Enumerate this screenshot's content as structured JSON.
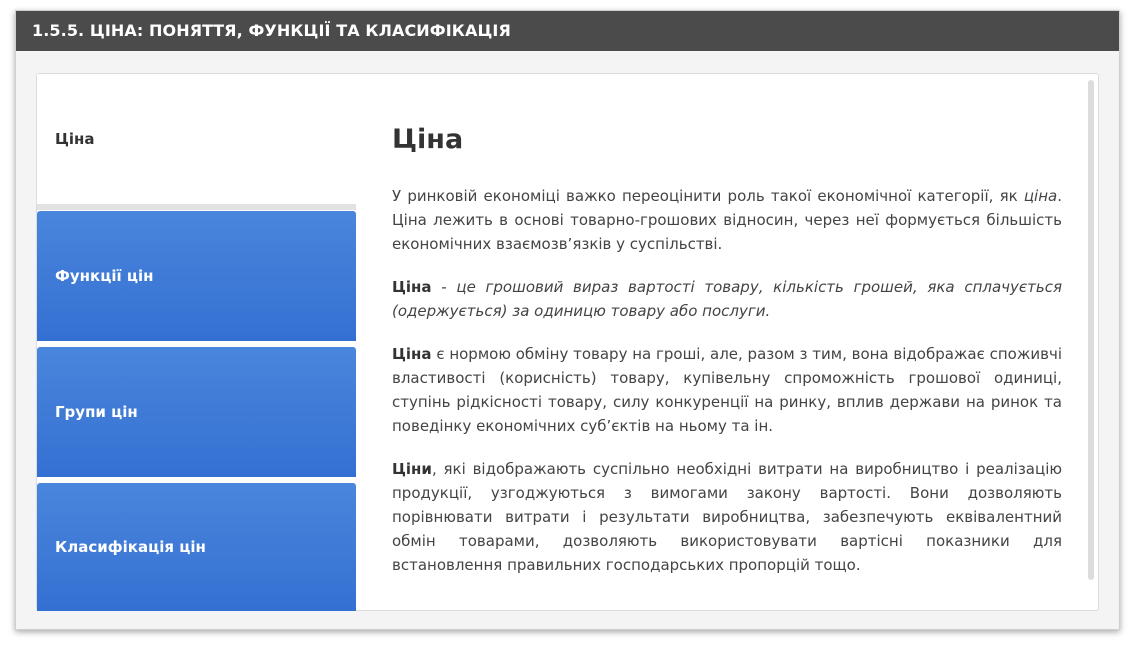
{
  "window": {
    "title": "1.5.5. ЦІНА: ПОНЯТТЯ, ФУНКЦІЇ ТА КЛАСИФІКАЦІЯ"
  },
  "tabs": [
    {
      "label": "Ціна",
      "active": true
    },
    {
      "label": "Функції цін",
      "active": false
    },
    {
      "label": "Групи цін",
      "active": false
    },
    {
      "label": "Класифікація цін",
      "active": false
    }
  ],
  "content": {
    "heading": "Ціна",
    "p1": {
      "text_a": "У ринковій економіці важко переоцінити роль такої економічної категорії, як ",
      "em": "ціна",
      "text_b": ". Ціна лежить в основі товарно-грошових відносин, через неї формується більшість економічних взаємозв’язків у суспільстві."
    },
    "p2": {
      "bold": "Ціна",
      "em": " - це грошовий вираз вартості товару, кількість грошей, яка сплачується (одержується) за одиницю товару або послуги."
    },
    "p3": {
      "bold": "Ціна",
      "text": " є нормою обміну товару на гроші, але, разом з тим, вона відображає споживчі властивості (корисність) товару, купівельну спроможність грошової одиниці, ступінь рідкісності товару, силу конкуренції на ринку, вплив держави на ринок та поведінку економічних суб’єктів на ньому та ін."
    },
    "p4": {
      "bold": "Ціни",
      "text": ", які відображають суспільно необхідні витрати на виробництво і реалізацію продукції, узгоджуються з вимогами закону вартості. Вони дозволяють порівнювати витрати і результати виробництва, забезпечують еквівалентний обмін товарами, дозволяють використовувати вартісні показники для встановлення правильних господарських пропорцій тощо."
    }
  }
}
